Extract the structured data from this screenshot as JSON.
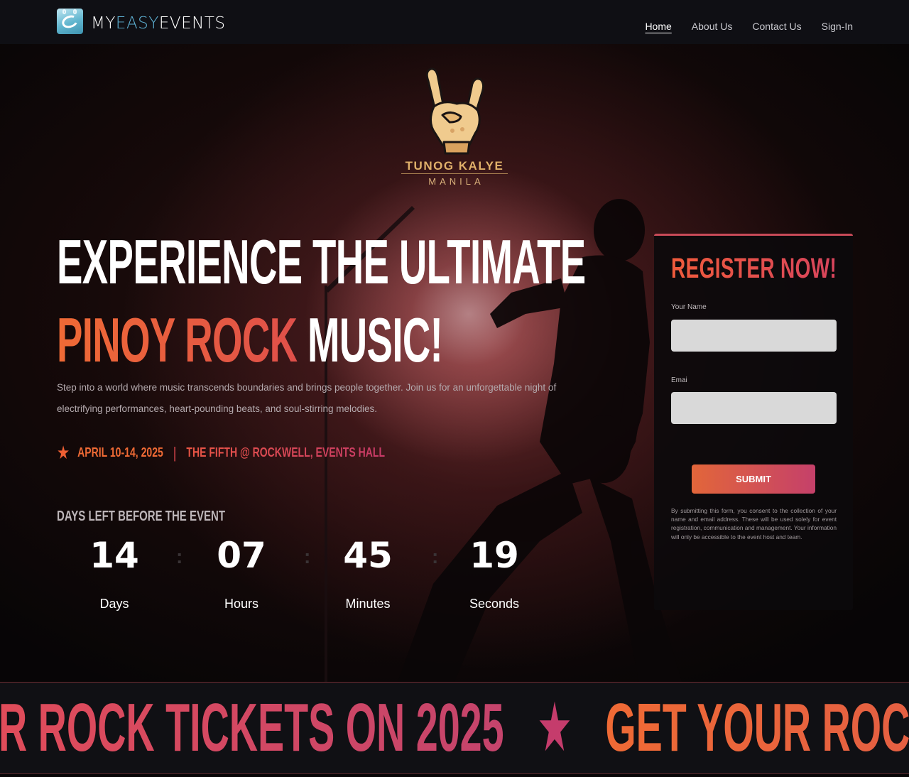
{
  "nav": {
    "logo_part1": "MY",
    "logo_part2": "EASY",
    "logo_part3": "EVENTS",
    "links": [
      "Home",
      "About Us",
      "Contact Us",
      "Sign-In"
    ],
    "active": "Home"
  },
  "brand_badge": {
    "icon": "rock-hand-icon",
    "title": "TUNOG KALYE",
    "subtitle": "MANILA"
  },
  "hero": {
    "line1": "EXPERIENCE THE ULTIMATE",
    "line2_highlight": "PINOY ROCK",
    "line2_rest": "MUSIC!",
    "intro": "Step into a world where music transcends boundaries and brings people together. Join us for an unforgettable night of electrifying performances, heart-pounding beats, and soul-stirring melodies.",
    "date": "APRIL 10-14, 2025",
    "separator": "|",
    "venue": "THE FIFTH @ ROCKWELL, EVENTS HALL"
  },
  "countdown": {
    "heading": "DAYS LEFT BEFORE THE EVENT",
    "units": [
      {
        "value": "14",
        "label": "Days"
      },
      {
        "value": "07",
        "label": "Hours"
      },
      {
        "value": "45",
        "label": "Minutes"
      },
      {
        "value": "19",
        "label": "Seconds"
      }
    ]
  },
  "register": {
    "title": "REGISTER NOW!",
    "name_label": "Your Name",
    "name_value": "",
    "email_label": "Emai",
    "email_value": "",
    "submit_label": "SUBMIT",
    "consent": "By submitting this form, you consent to the collection of your name and email address. These will be used solely for event registration, communication and management. Your information will only be accessible to the event host and team."
  },
  "marquee": {
    "text1": "R ROCK TICKETS ON 2025",
    "star": "★",
    "text2": "GET YOUR ROCK T"
  },
  "colors": {
    "accent_orange": "#ef6a35",
    "accent_magenta": "#c5406a",
    "nav_bg": "#0f0f14"
  }
}
